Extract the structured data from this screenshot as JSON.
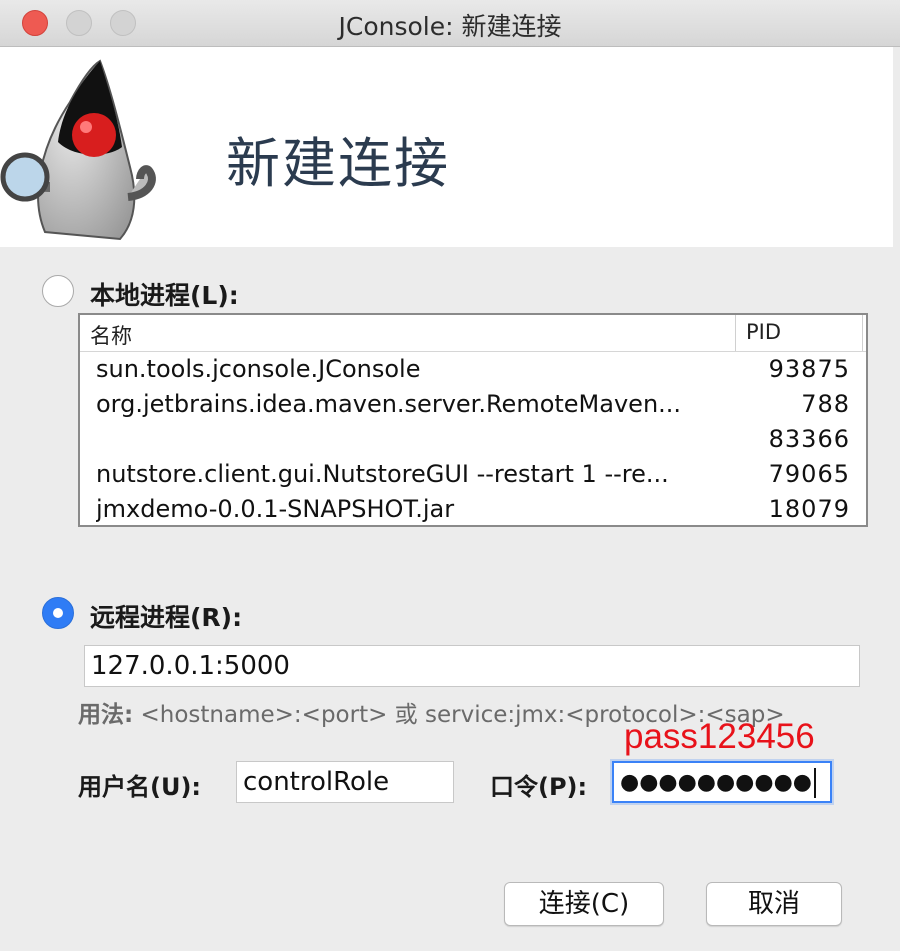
{
  "window": {
    "title": "JConsole: 新建连接"
  },
  "header": {
    "title": "新建连接"
  },
  "local": {
    "label": "本地进程(L):",
    "selected": false,
    "columns": {
      "name": "名称",
      "pid": "PID"
    },
    "rows": [
      {
        "name": "sun.tools.jconsole.JConsole",
        "pid": "93875"
      },
      {
        "name": "org.jetbrains.idea.maven.server.RemoteMaven...",
        "pid": "788"
      },
      {
        "name": "",
        "pid": "83366"
      },
      {
        "name": "nutstore.client.gui.NutstoreGUI --restart 1 --re...",
        "pid": "79065"
      },
      {
        "name": "jmxdemo-0.0.1-SNAPSHOT.jar",
        "pid": "18079"
      }
    ]
  },
  "remote": {
    "label": "远程进程(R):",
    "selected": true,
    "address": "127.0.0.1:5000",
    "usage_prefix": "用法:",
    "usage_text": " <hostname>:<port> 或 service:jmx:<protocol>:<sap>"
  },
  "credentials": {
    "username_label": "用户名(U):",
    "username_value": "controlRole",
    "password_label": "口令(P):",
    "password_mask": "●●●●●●●●●●",
    "annotation": "pass123456"
  },
  "buttons": {
    "connect": "连接(C)",
    "cancel": "取消"
  },
  "colors": {
    "accent": "#2f7cf5",
    "annotation": "#e8121a",
    "header_text": "#2b3b4f"
  }
}
